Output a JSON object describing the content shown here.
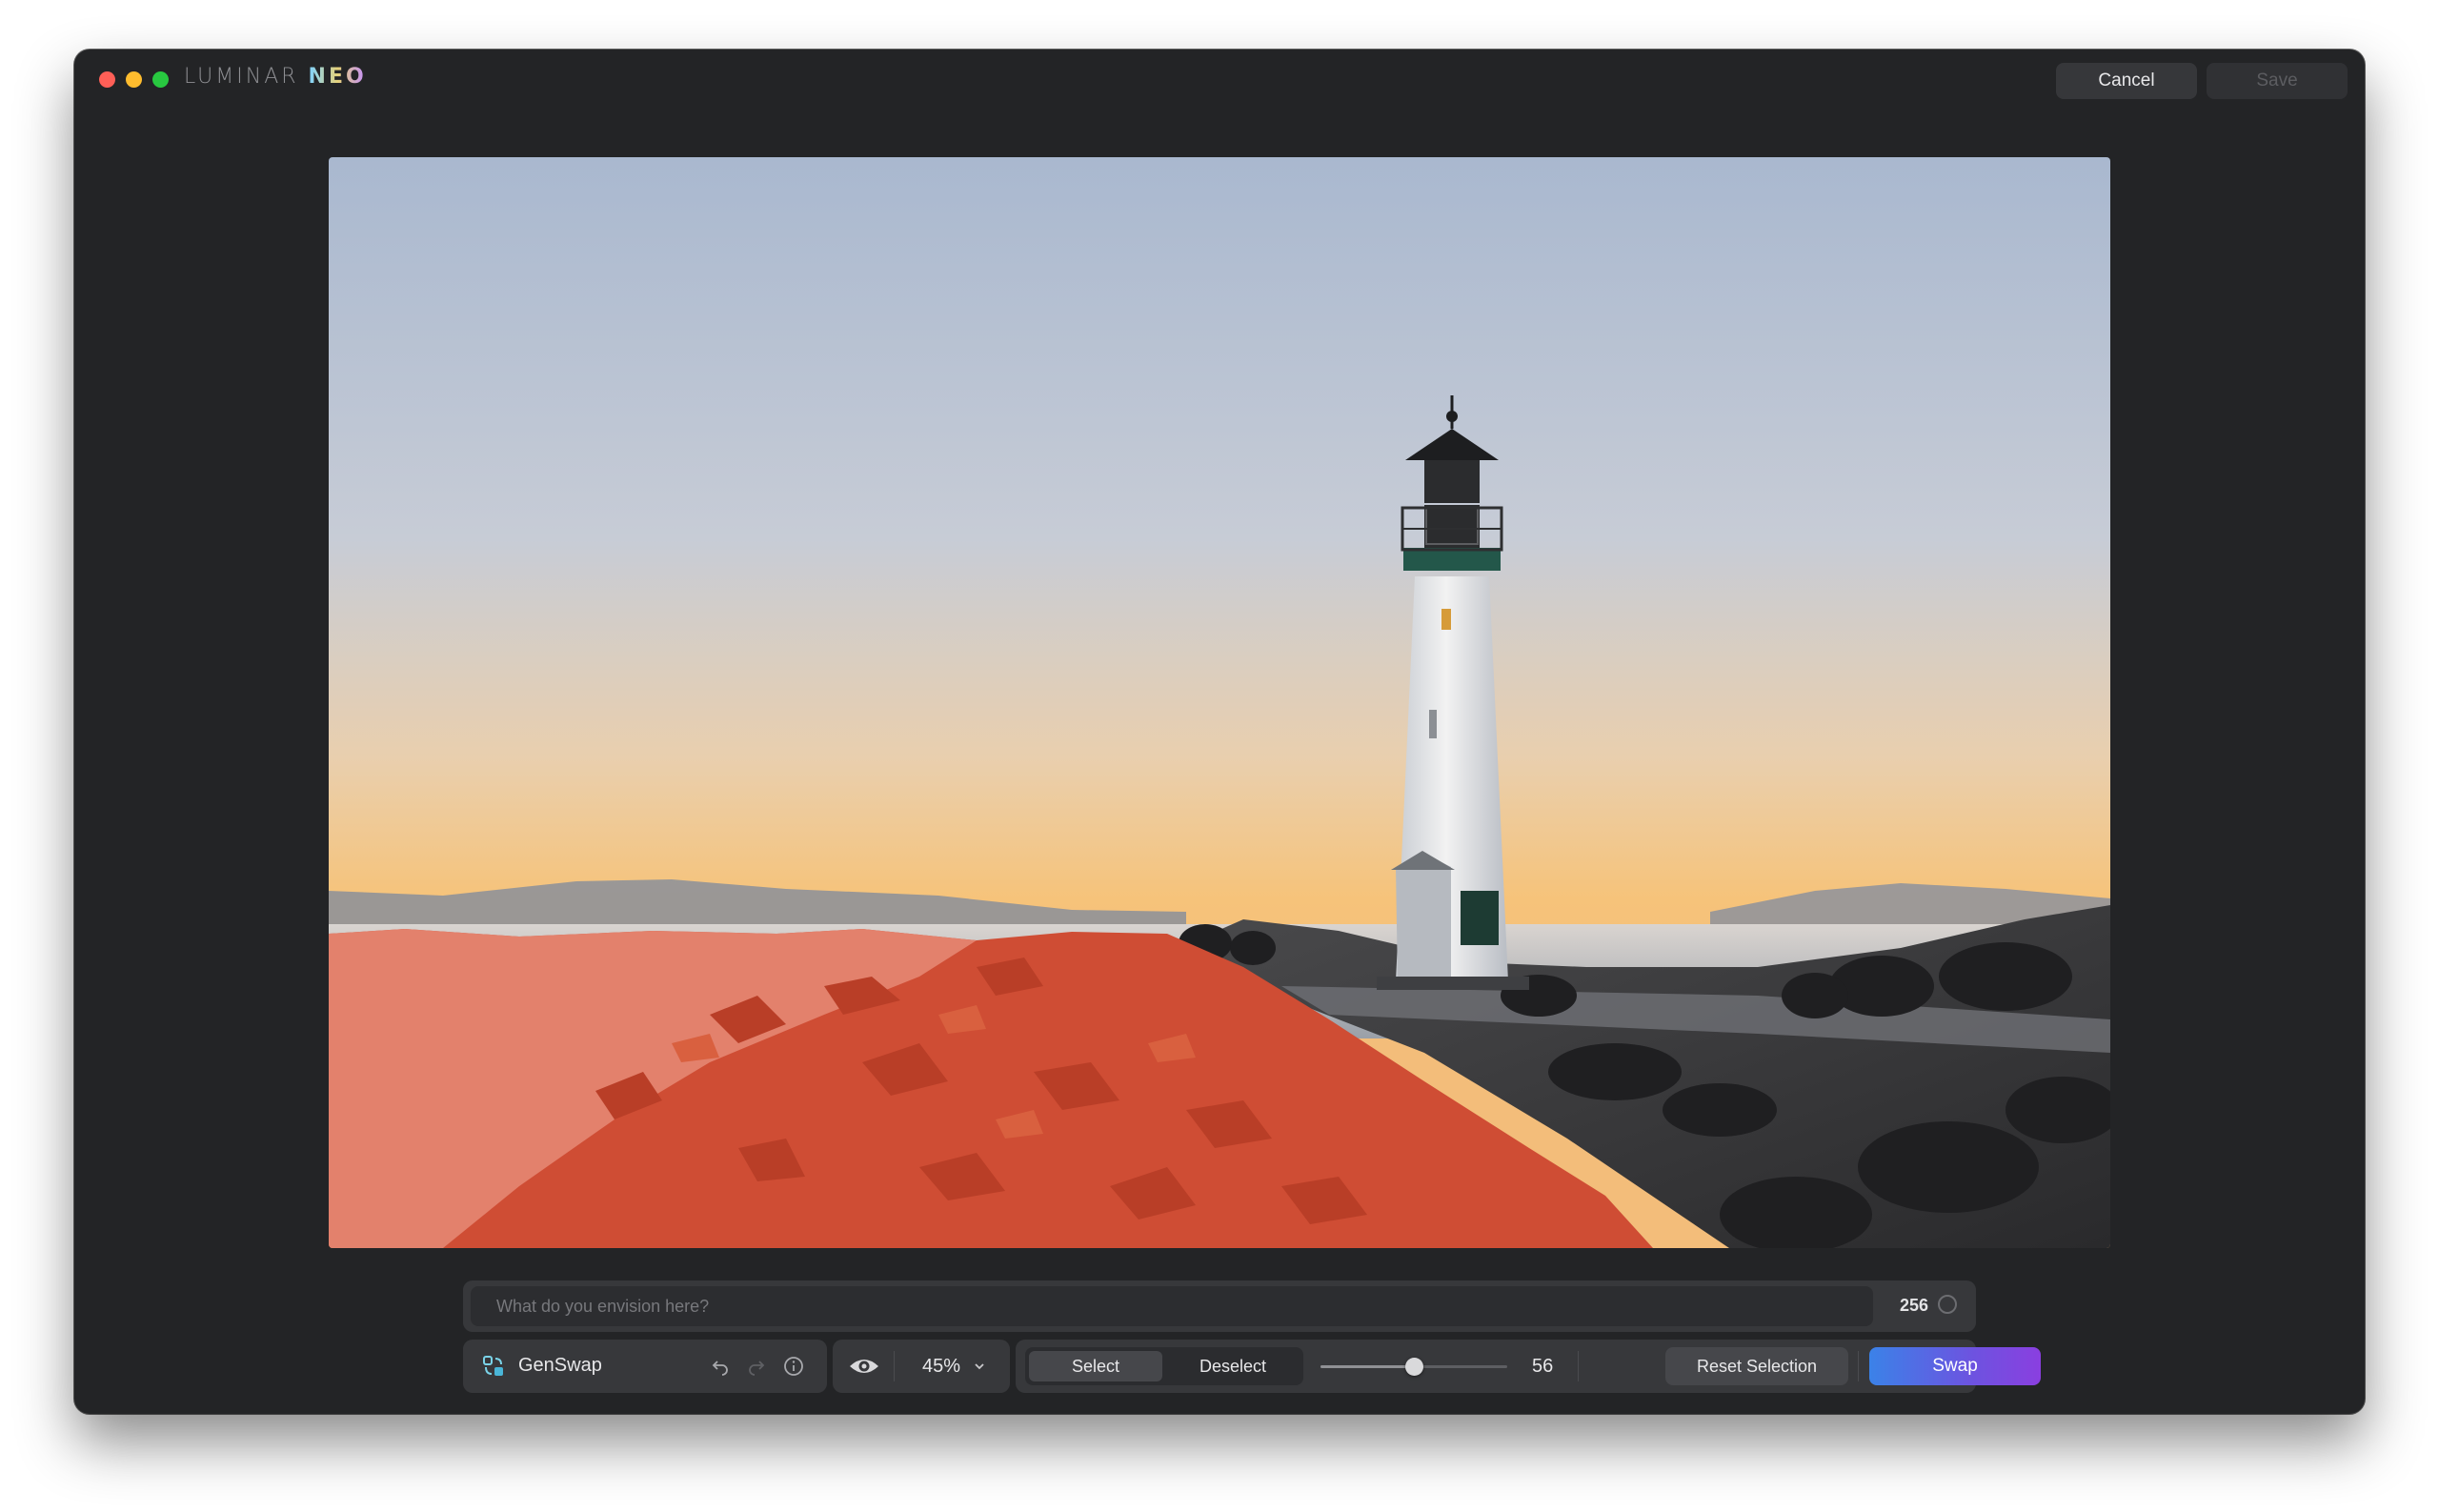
{
  "window": {
    "app_name": "LUMINAR",
    "app_name_accent": "NEO",
    "cancel_label": "Cancel",
    "save_label": "Save"
  },
  "prompt": {
    "placeholder": "What do you envision here?",
    "value": "",
    "char_count": "256"
  },
  "toolbar": {
    "tool_name": "GenSwap",
    "zoom": "45%",
    "select_label": "Select",
    "deselect_label": "Deselect",
    "brush_size": "56",
    "brush_size_value": 56,
    "brush_size_fraction": 0.5,
    "reset_label": "Reset Selection",
    "swap_label": "Swap"
  },
  "icons": {
    "genswap": "genswap-icon",
    "undo": "undo-icon",
    "redo": "redo-icon",
    "info": "info-icon",
    "preview": "eye-icon",
    "zoom_dropdown": "chevron-down-icon"
  },
  "colors": {
    "window_bg": "#232426",
    "panel_bg": "#37383b",
    "mask_overlay": "#e0543c",
    "swap_gradient_start": "#3b82e8",
    "swap_gradient_end": "#8a3fe0"
  }
}
